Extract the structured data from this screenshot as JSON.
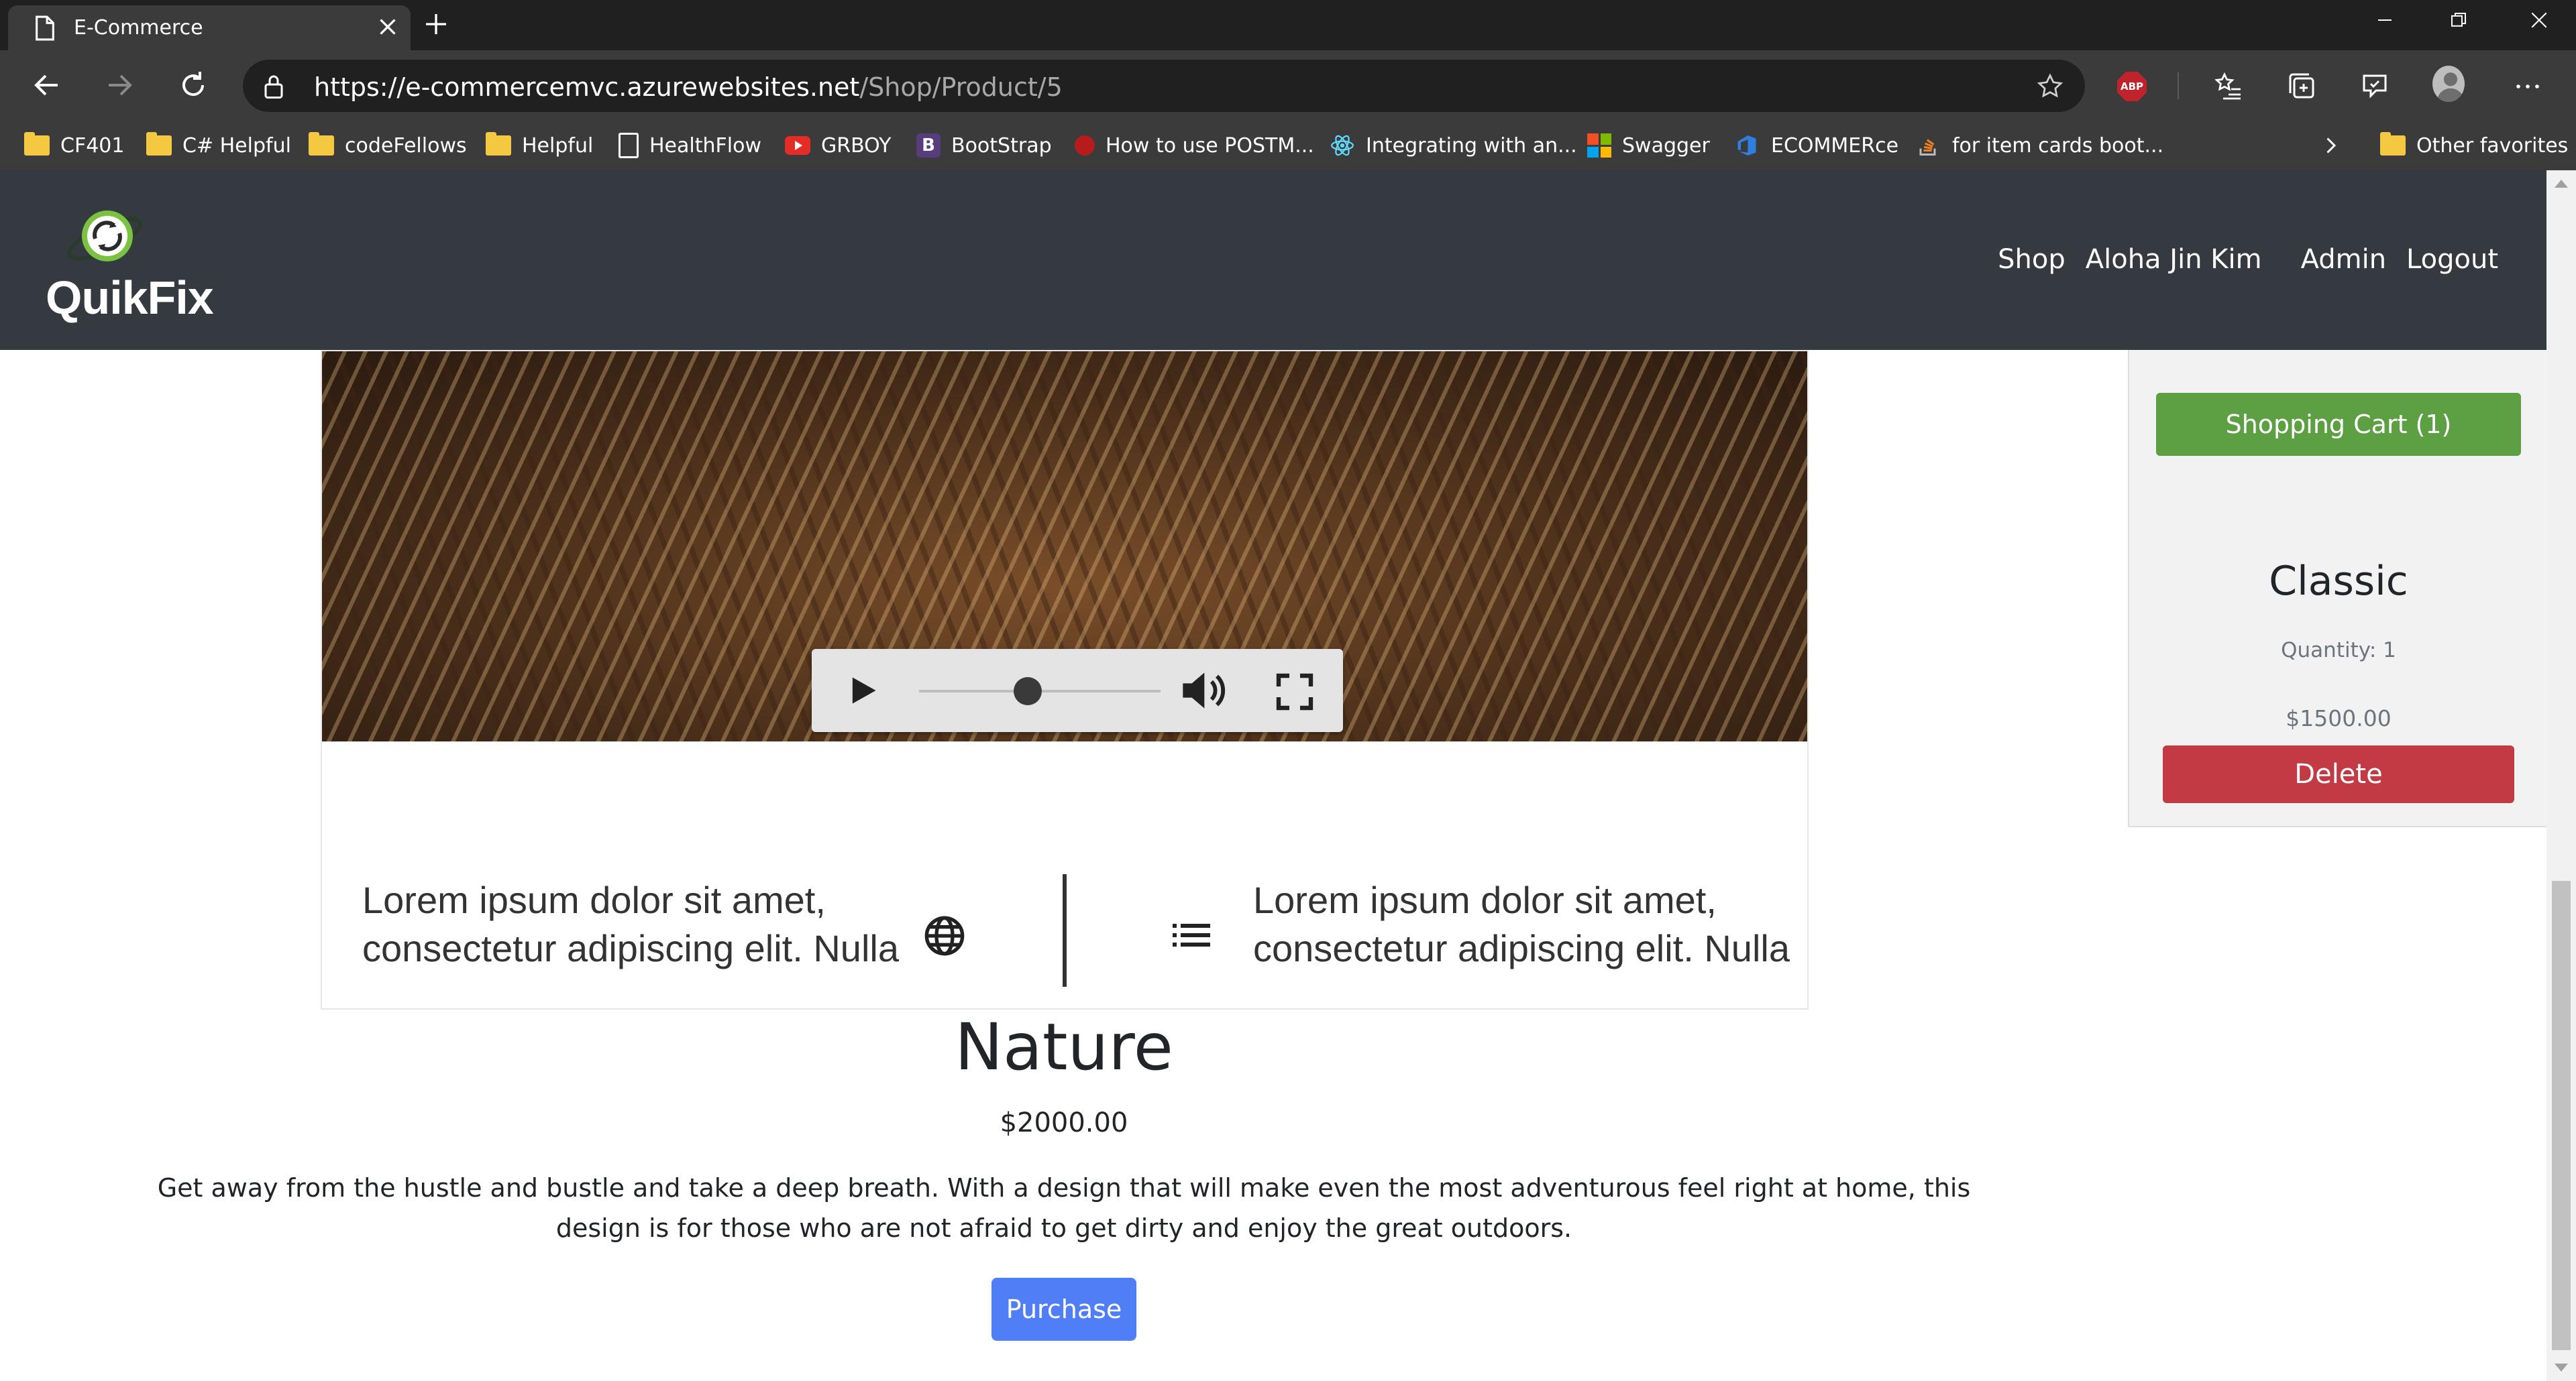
{
  "browser": {
    "tab_title": "E-Commerce",
    "url_host": "https://e-commercemvc.azurewebsites.net",
    "url_path": "/Shop/Product/5",
    "abp_label": "ABP",
    "bookmarks": [
      {
        "label": "CF401",
        "icon": "folder-icon"
      },
      {
        "label": "C# Helpful",
        "icon": "folder-icon"
      },
      {
        "label": "codeFellows",
        "icon": "folder-icon"
      },
      {
        "label": "Helpful",
        "icon": "folder-icon"
      },
      {
        "label": "HealthFlow",
        "icon": "page-icon"
      },
      {
        "label": "GRBOY",
        "icon": "youtube-icon"
      },
      {
        "label": "BootStrap",
        "icon": "bootstrap-icon"
      },
      {
        "label": "How to use POSTM...",
        "icon": "postman-icon"
      },
      {
        "label": "Integrating with an...",
        "icon": "react-icon"
      },
      {
        "label": "Swagger",
        "icon": "microsoft-icon"
      },
      {
        "label": "ECOMMERce",
        "icon": "azure-devops-icon"
      },
      {
        "label": "for item cards boot...",
        "icon": "stackoverflow-icon"
      }
    ],
    "other_favorites": "Other favorites"
  },
  "site": {
    "logo_text": "QuikFix",
    "nav": {
      "shop": "Shop",
      "user": "Aloha Jin Kim",
      "admin": "Admin",
      "logout": "Logout"
    }
  },
  "product": {
    "image_caption_left": [
      "Lorem ipsum dolor sit amet,",
      "consectetur adipiscing elit. Nulla"
    ],
    "image_caption_right": [
      "Lorem ipsum dolor sit amet,",
      "consectetur adipiscing elit. Nulla"
    ],
    "name": "Nature",
    "price": "$2000.00",
    "description": "Get away from the hustle and bustle and take a deep breath. With a design that will make even the most adventurous feel right at home, this design is for those who are not afraid to get dirty and enjoy the great outdoors.",
    "purchase_label": "Purchase",
    "player_progress": 0.45
  },
  "cart": {
    "button_label": "Shopping Cart (1)",
    "item": {
      "name": "Classic",
      "quantity": "Quantity: 1",
      "price": "$1500.00"
    },
    "delete_label": "Delete"
  },
  "colors": {
    "navbar": "#343a40",
    "cart_button": "#5d9f43",
    "delete_button": "#c13a44",
    "purchase_button": "#4f7ef7"
  }
}
